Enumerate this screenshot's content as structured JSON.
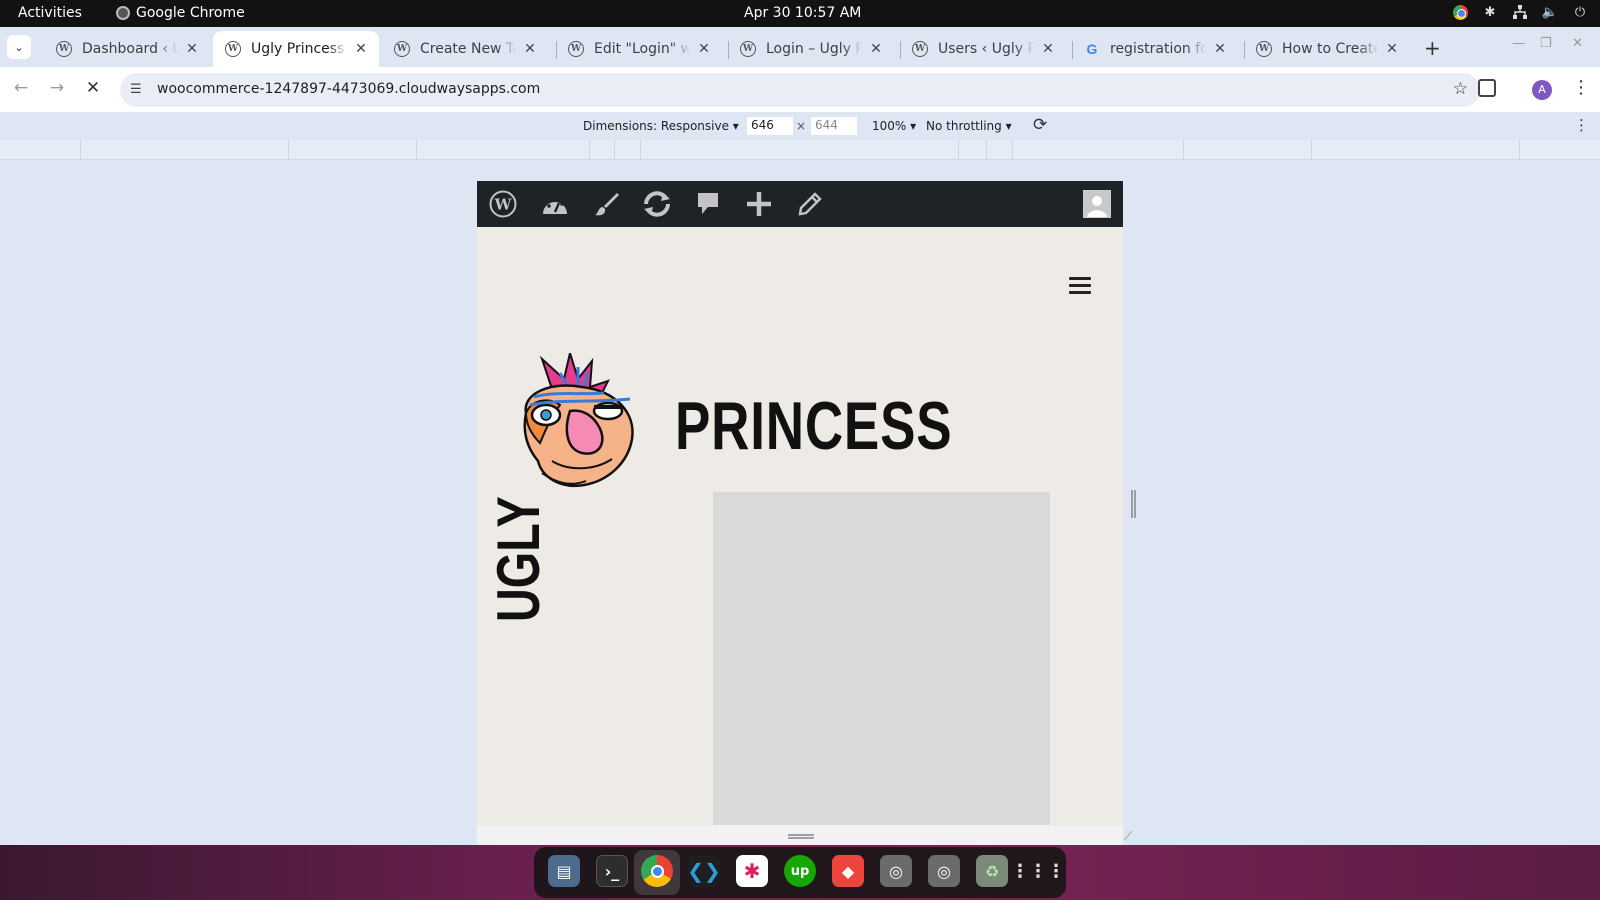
{
  "system": {
    "activities": "Activities",
    "app_name": "Google Chrome",
    "clock": "Apr 30  10:57 AM"
  },
  "tabs": [
    {
      "title": "Dashboard ‹ Ugly Princess",
      "favicon": "wordpress-icon"
    },
    {
      "title": "Ugly Princess",
      "favicon": "wordpress-icon",
      "active": true
    },
    {
      "title": "Create New Tab",
      "favicon": "wordpress-icon"
    },
    {
      "title": "Edit \"Login\" with",
      "favicon": "wordpress-icon"
    },
    {
      "title": "Login – Ugly Princess",
      "favicon": "wordpress-icon"
    },
    {
      "title": "Users ‹ Ugly Princess",
      "favicon": "wordpress-icon"
    },
    {
      "title": "registration form",
      "favicon": "google-icon"
    },
    {
      "title": "How to Create",
      "favicon": "wordpress-icon"
    }
  ],
  "omnibox": {
    "url": "woocommerce-1247897-4473069.cloudwaysapps.com"
  },
  "profile_initial": "A",
  "devtools": {
    "dimensions_label": "Dimensions: Responsive",
    "width": "646",
    "height": "644",
    "separator": "×",
    "zoom": "100%",
    "throttling": "No throttling"
  },
  "site": {
    "word_top": "PRINCESS",
    "word_vertical": "UGLY"
  },
  "dock_apps": [
    "files-icon",
    "terminal-icon",
    "chrome-icon",
    "vscode-icon",
    "slack-icon",
    "upwork-icon",
    "anydesk-icon",
    "disk-icon",
    "disk-icon",
    "trash-icon",
    "app-grid-icon"
  ],
  "colors": {
    "wp_admin_bar": "#1d2327",
    "site_background": "#eeebe6",
    "hero_placeholder": "#d9d9d9"
  }
}
